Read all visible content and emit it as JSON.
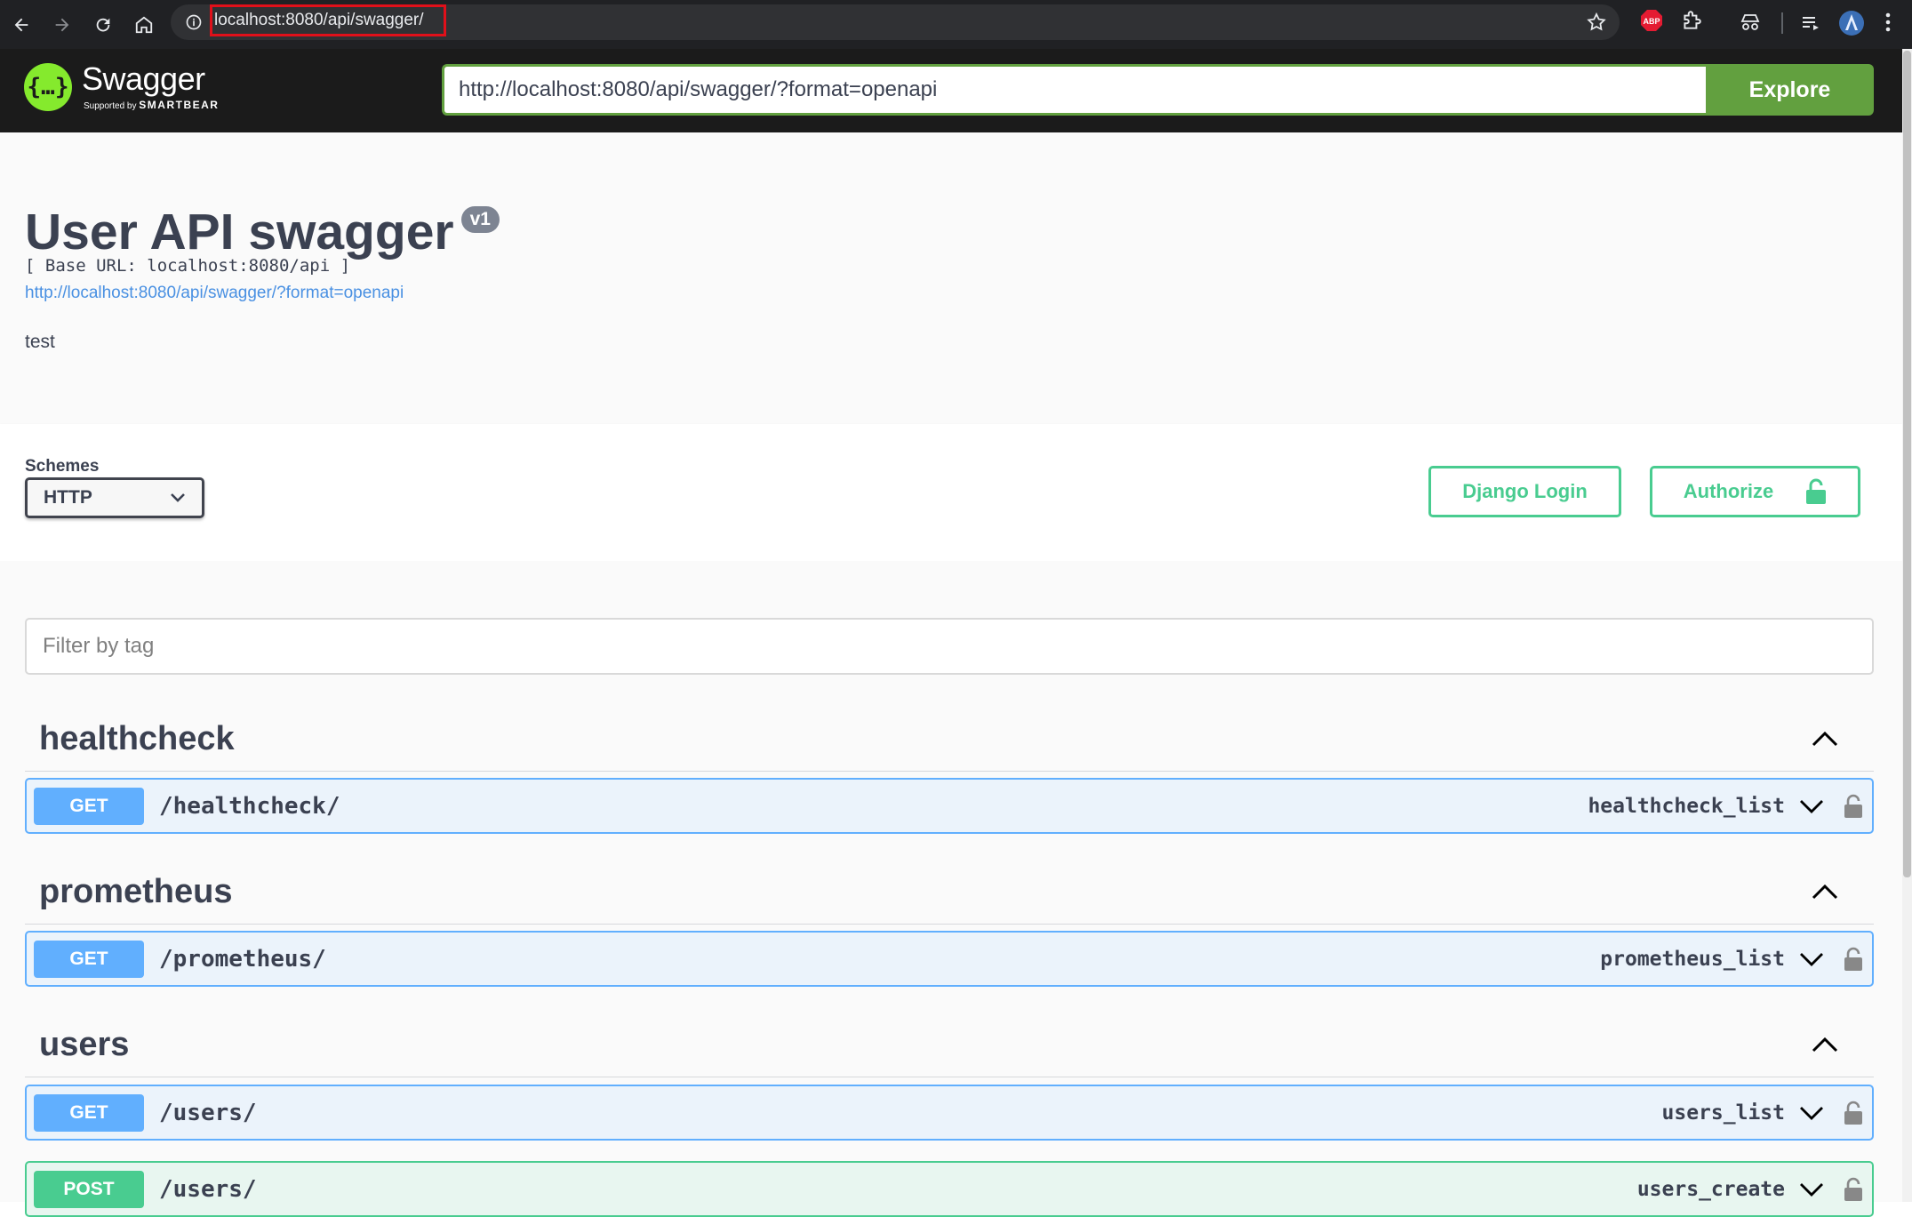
{
  "browser": {
    "url": "localhost:8080/api/swagger/"
  },
  "topbar": {
    "logo_name": "Swagger",
    "logo_supported": "Supported by",
    "logo_company": "SMARTBEAR",
    "spec_url": "http://localhost:8080/api/swagger/?format=openapi",
    "explore_label": "Explore"
  },
  "info": {
    "title": "User API swagger",
    "version": "v1",
    "base_url": "[ Base URL: localhost:8080/api ]",
    "spec_link": "http://localhost:8080/api/swagger/?format=openapi",
    "description": "test"
  },
  "schemes": {
    "label": "Schemes",
    "selected": "HTTP",
    "django_login_label": "Django Login",
    "authorize_label": "Authorize"
  },
  "filter": {
    "placeholder": "Filter by tag"
  },
  "tags": [
    {
      "name": "healthcheck",
      "operations": [
        {
          "method": "GET",
          "path": "/healthcheck/",
          "operation_id": "healthcheck_list"
        }
      ]
    },
    {
      "name": "prometheus",
      "operations": [
        {
          "method": "GET",
          "path": "/prometheus/",
          "operation_id": "prometheus_list"
        }
      ]
    },
    {
      "name": "users",
      "operations": [
        {
          "method": "GET",
          "path": "/users/",
          "operation_id": "users_list"
        },
        {
          "method": "POST",
          "path": "/users/",
          "operation_id": "users_create"
        }
      ]
    }
  ],
  "colors": {
    "get": "#61affe",
    "post": "#49cc90",
    "explore": "#62a03f",
    "logo": "#85ea2d"
  }
}
